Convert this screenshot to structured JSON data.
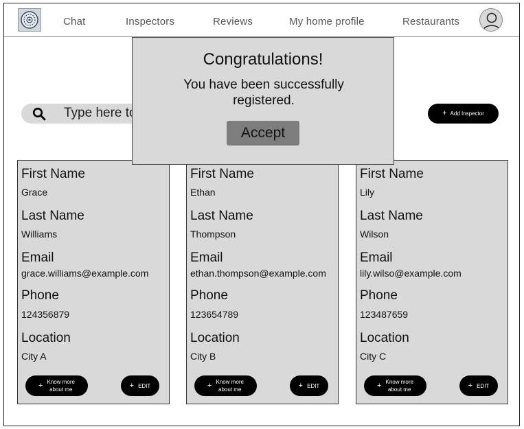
{
  "nav": {
    "logo_icon": "app-logo-icon",
    "items": [
      "Chat",
      "Inspectors",
      "Reviews",
      "My home profile",
      "Restaurants"
    ],
    "avatar_icon": "user-avatar-icon"
  },
  "search": {
    "icon": "search-icon",
    "placeholder": "Type here to search"
  },
  "add_button": {
    "icon": "plus-icon",
    "label": "Add Inspector"
  },
  "field_labels": {
    "first_name": "First Name",
    "last_name": "Last Name",
    "email": "Email",
    "phone": "Phone",
    "location": "Location"
  },
  "cards": [
    {
      "first_name": "Grace",
      "last_name": "Williams",
      "email": "grace.williams@example.com",
      "phone": "124356879",
      "location": "City A"
    },
    {
      "first_name": "Ethan",
      "last_name": "Thompson",
      "email": "ethan.thompson@example.com",
      "phone": "123654789",
      "location": "City B"
    },
    {
      "first_name": "Lily",
      "last_name": "Wilson",
      "email": "lily.wilso@example.com",
      "phone": "123487659",
      "location": "City C"
    }
  ],
  "card_buttons": {
    "know_more_line1": "Know more",
    "know_more_line2": "about me",
    "edit": "EDIT"
  },
  "modal": {
    "title": "Congratulations!",
    "message": "You have been successfully registered.",
    "accept": "Accept"
  }
}
